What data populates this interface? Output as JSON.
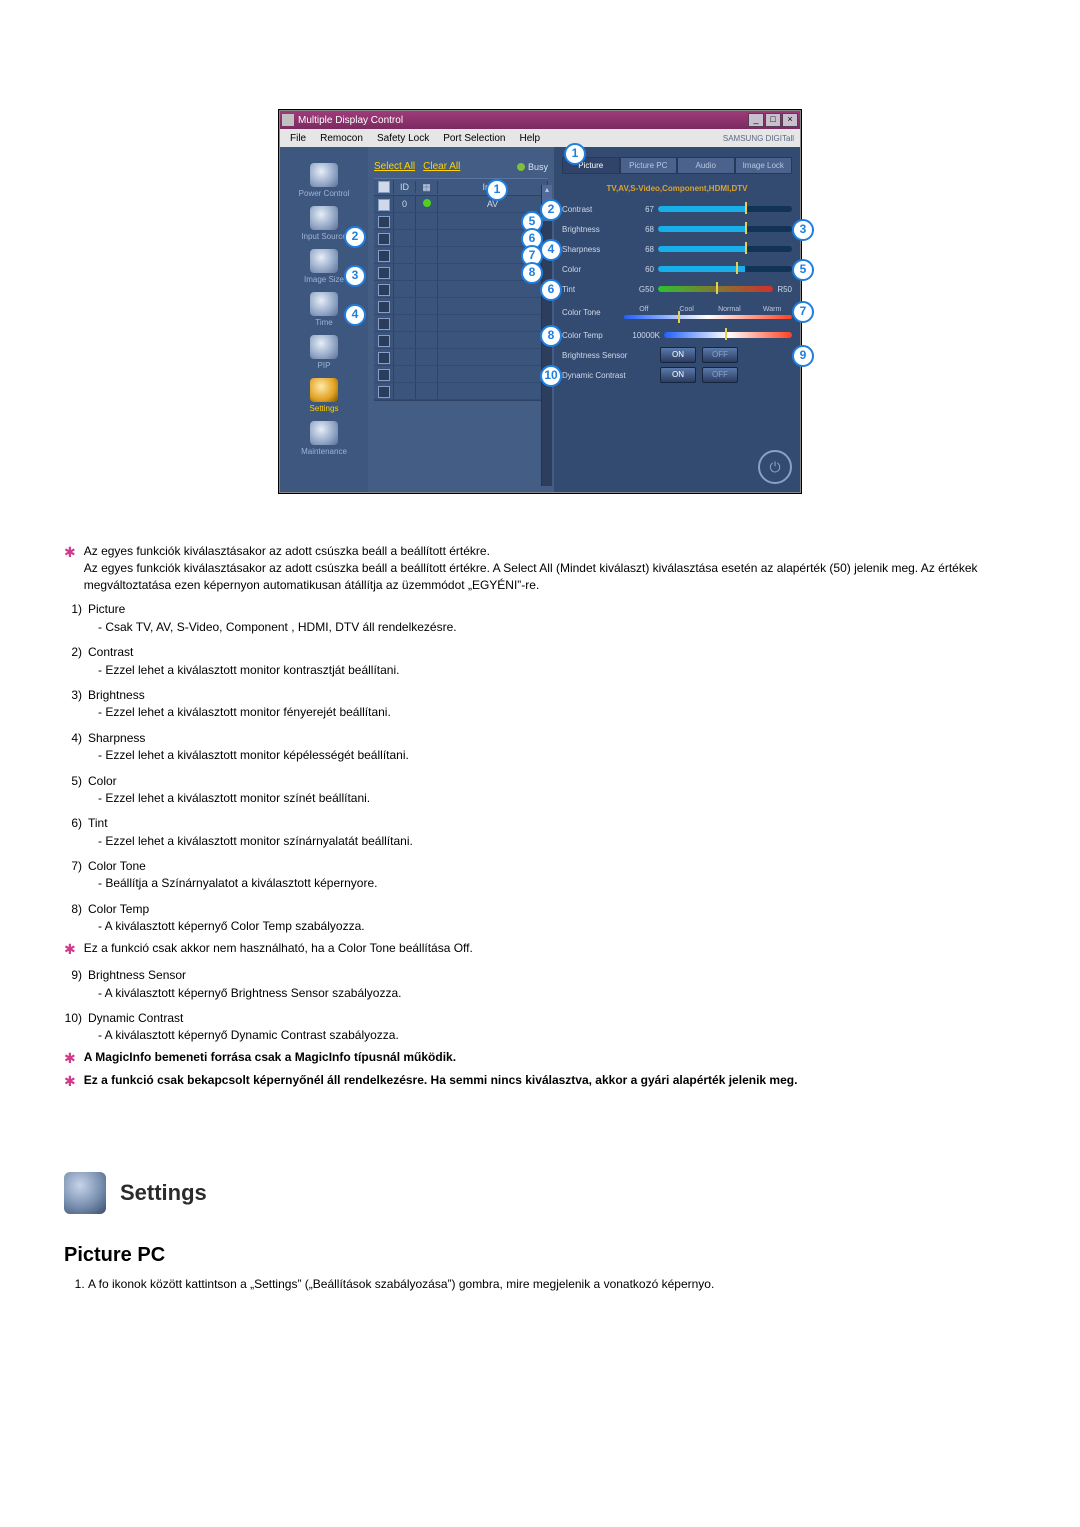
{
  "window": {
    "title": "Multiple Display Control",
    "menu": [
      "File",
      "Remocon",
      "Safety Lock",
      "Port Selection",
      "Help"
    ],
    "brand": "SAMSUNG DIGITall"
  },
  "sidebar": {
    "items": [
      {
        "label": "Power Control"
      },
      {
        "label": "Input Source"
      },
      {
        "label": "Image Size"
      },
      {
        "label": "Time"
      },
      {
        "label": "PIP"
      },
      {
        "label": "Settings"
      },
      {
        "label": "Maintenance"
      }
    ]
  },
  "mid": {
    "select_all": "Select All",
    "clear_all": "Clear All",
    "busy": "Busy",
    "head_id": "ID",
    "head_input": "Input",
    "first_row_id": "0",
    "first_row_input": "AV"
  },
  "tabs": [
    "Picture",
    "Picture PC",
    "Audio",
    "Image Lock"
  ],
  "sub_heading": "TV,AV,S-Video,Component,HDMI,DTV",
  "ctrls": {
    "contrast": {
      "label": "Contrast",
      "value": "67"
    },
    "brightness": {
      "label": "Brightness",
      "value": "68"
    },
    "sharpness": {
      "label": "Sharpness",
      "value": "68"
    },
    "color": {
      "label": "Color",
      "value": "60"
    },
    "tint": {
      "label": "Tint",
      "left": "G50",
      "right": "R50"
    },
    "tone": {
      "label": "Color Tone",
      "opts": [
        "Off",
        "Cool",
        "Normal",
        "Warm"
      ]
    },
    "temp": {
      "label": "Color Temp",
      "value": "10000K"
    },
    "bsensor": {
      "label": "Brightness Sensor",
      "on": "ON",
      "off": "OFF"
    },
    "dcontrast": {
      "label": "Dynamic Contrast",
      "on": "ON",
      "off": "OFF"
    }
  },
  "notes": {
    "line1": "Az egyes funkciók kiválasztásakor az adott csúszka beáll a beállított értékre.",
    "line2": "Az egyes funkciók kiválasztásakor az adott csúszka beáll a beállított értékre. A Select All (Mindet kiválaszt) kiválasztása esetén az alapérték (50) jelenik meg. Az értékek megváltoztatása ezen képernyon automatikusan átállítja az üzemmódot „EGYÉNI”-re.",
    "off_note": "Ez a funkció csak akkor nem használható, ha a Color Tone beállítása Off.",
    "magic": "A MagicInfo bemeneti forrása csak a MagicInfo típusnál működik.",
    "power": "Ez a funkció csak bekapcsolt képernyőnél áll rendelkezésre. Ha semmi nincs kiválasztva, akkor a gyári alapérték jelenik meg."
  },
  "list": [
    {
      "n": "1)",
      "t": "Picture",
      "d": "- Csak TV, AV, S-Video, Component , HDMI, DTV áll rendelkezésre."
    },
    {
      "n": "2)",
      "t": "Contrast",
      "d": "- Ezzel lehet a kiválasztott monitor kontrasztját beállítani."
    },
    {
      "n": "3)",
      "t": "Brightness",
      "d": "- Ezzel lehet a kiválasztott monitor fényerejét beállítani."
    },
    {
      "n": "4)",
      "t": "Sharpness",
      "d": "- Ezzel lehet a kiválasztott monitor képélességét beállítani."
    },
    {
      "n": "5)",
      "t": "Color",
      "d": "- Ezzel lehet a kiválasztott monitor színét beállítani."
    },
    {
      "n": "6)",
      "t": "Tint",
      "d": "- Ezzel lehet a kiválasztott monitor színárnyalatát beállítani."
    },
    {
      "n": "7)",
      "t": "Color Tone",
      "d": "- Beállítja a Színárnyalatot a kiválasztott képernyore."
    },
    {
      "n": "8)",
      "t": "Color Temp",
      "d": "- A kiválasztott képernyő Color Temp szabályozza."
    },
    {
      "n": "9)",
      "t": "Brightness Sensor",
      "d": "- A kiválasztott képernyő Brightness Sensor szabályozza."
    },
    {
      "n": "10)",
      "t": "Dynamic Contrast",
      "d": "- A kiválasztott képernyő Dynamic Contrast szabályozza."
    }
  ],
  "settings": {
    "heading": "Settings",
    "sub": "Picture PC",
    "step1": "A fo ikonok között kattintson a „Settings” („Beállítások szabályozása”) gombra, mire megjelenik a vonatkozó képernyo."
  }
}
